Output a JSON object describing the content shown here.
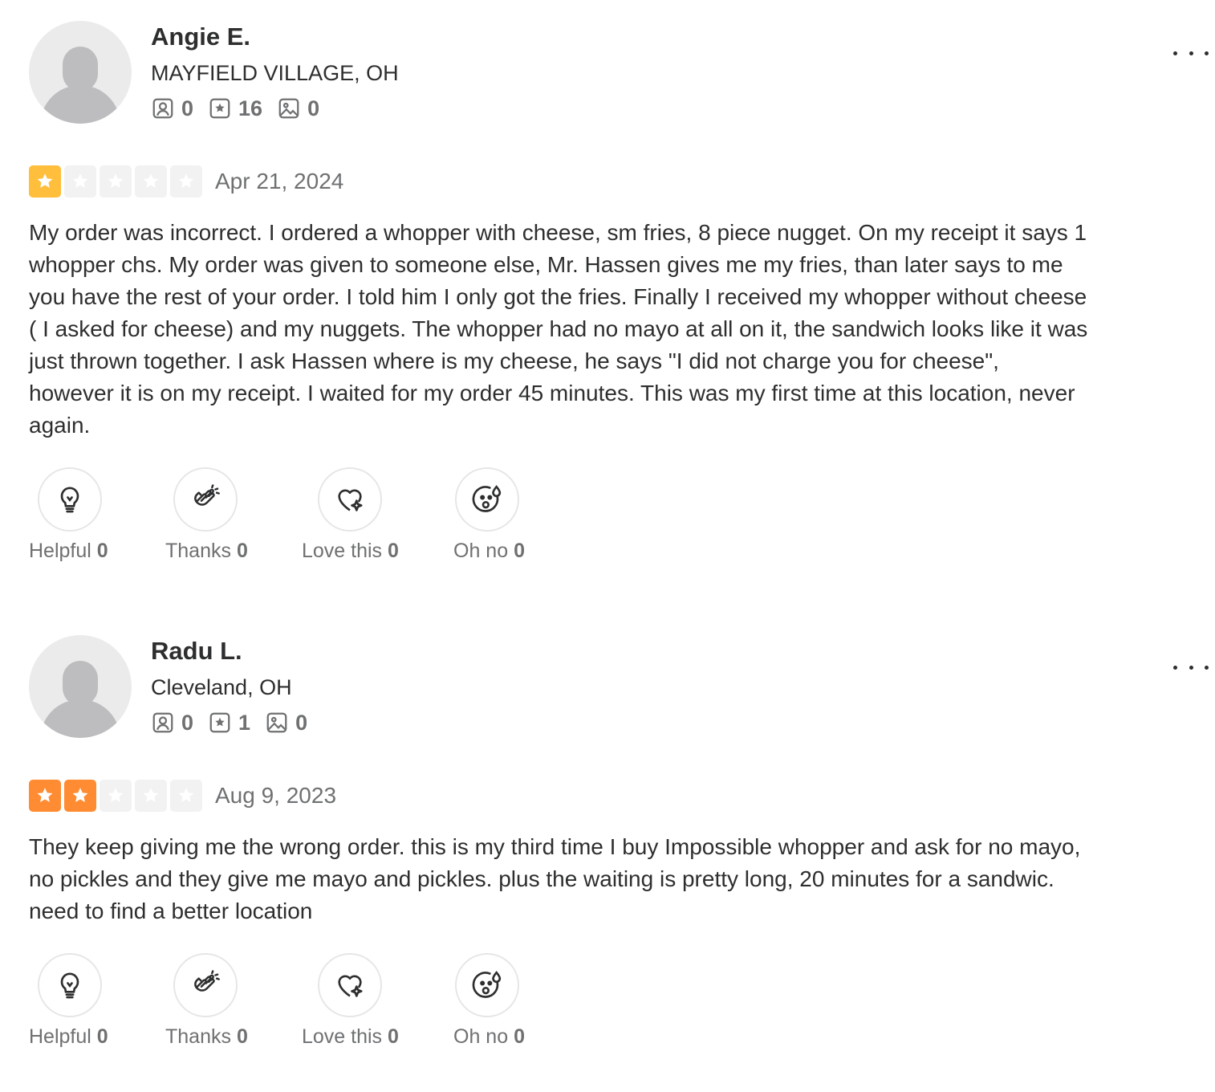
{
  "colors": {
    "star_one": "#ffbe3b",
    "star_two": "#ff8c32",
    "star_empty": "#f2f2f2",
    "text": "#2d2e2f",
    "muted": "#6e7072"
  },
  "reviews": [
    {
      "user": {
        "name": "Angie E.",
        "location": "MAYFIELD VILLAGE, OH",
        "friends": "0",
        "reviews": "16",
        "photos": "0"
      },
      "rating": 1,
      "rating_max": 5,
      "date": "Apr 21, 2024",
      "text": "My order was incorrect. I ordered a whopper with cheese, sm fries, 8 piece nugget. On my receipt it says 1 whopper chs. My order was given to someone else, Mr. Hassen gives me my fries, than later says to me you have the rest of your order. I told him I only got the fries. Finally I received my whopper without cheese ( I asked for cheese) and my nuggets. The whopper had no mayo at all on it, the sandwich looks like it was just thrown together. I ask Hassen where is my cheese, he says \"I did not charge you for cheese\", however it is on my receipt. I waited for my order 45 minutes. This was my first time at this location, never again.",
      "reactions": {
        "helpful_label": "Helpful",
        "helpful_count": "0",
        "thanks_label": "Thanks",
        "thanks_count": "0",
        "love_label": "Love this",
        "love_count": "0",
        "ohno_label": "Oh no",
        "ohno_count": "0"
      }
    },
    {
      "user": {
        "name": "Radu L.",
        "location": "Cleveland, OH",
        "friends": "0",
        "reviews": "1",
        "photos": "0"
      },
      "rating": 2,
      "rating_max": 5,
      "date": "Aug 9, 2023",
      "text": "They keep giving me the wrong order. this is my third time I buy Impossible whopper and ask for no mayo, no pickles and they give me mayo and pickles. plus the waiting is pretty long, 20 minutes for a sandwic. need to find a better location",
      "reactions": {
        "helpful_label": "Helpful",
        "helpful_count": "0",
        "thanks_label": "Thanks",
        "thanks_count": "0",
        "love_label": "Love this",
        "love_count": "0",
        "ohno_label": "Oh no",
        "ohno_count": "0"
      }
    }
  ],
  "icons": {
    "friends": "friends-icon",
    "reviews": "reviews-star-icon",
    "photos": "photos-icon",
    "more": "more-options-icon",
    "helpful": "lightbulb-icon",
    "thanks": "clapping-hands-icon",
    "love": "heart-sparkle-icon",
    "ohno": "sweat-face-icon"
  }
}
